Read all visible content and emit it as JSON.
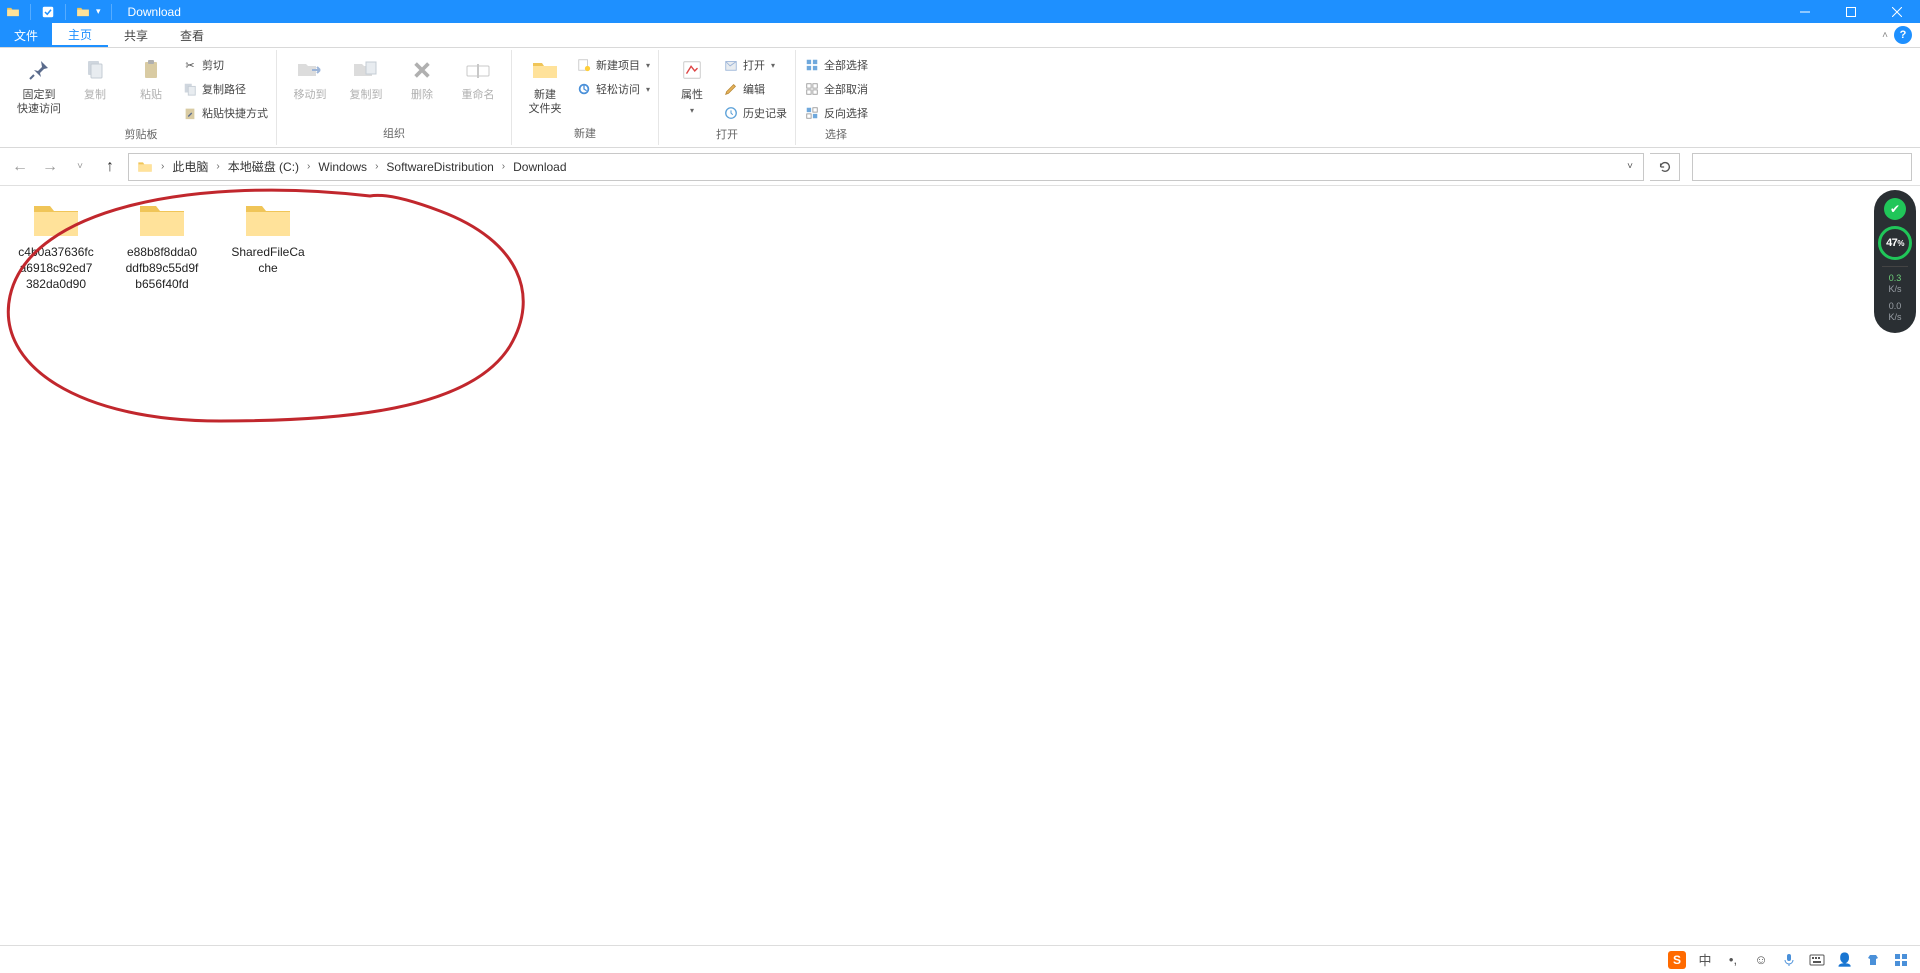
{
  "window": {
    "title": "Download"
  },
  "tabs": {
    "file": "文件",
    "items": [
      "主页",
      "共享",
      "查看"
    ],
    "active_index": 0
  },
  "ribbon": {
    "clipboard": {
      "label": "剪贴板",
      "pin": "固定到\n快速访问",
      "copy": "复制",
      "paste": "粘贴",
      "cut": "剪切",
      "copy_path": "复制路径",
      "paste_shortcut": "粘贴快捷方式"
    },
    "organize": {
      "label": "组织",
      "move_to": "移动到",
      "copy_to": "复制到",
      "delete": "删除",
      "rename": "重命名"
    },
    "new": {
      "label": "新建",
      "new_folder": "新建\n文件夹",
      "new_item": "新建项目",
      "easy_access": "轻松访问"
    },
    "open": {
      "label": "打开",
      "properties": "属性",
      "open": "打开",
      "edit": "编辑",
      "history": "历史记录"
    },
    "select": {
      "label": "选择",
      "select_all": "全部选择",
      "select_none": "全部取消",
      "invert": "反向选择"
    }
  },
  "breadcrumb": {
    "items": [
      "此电脑",
      "本地磁盘 (C:)",
      "Windows",
      "SoftwareDistribution",
      "Download"
    ]
  },
  "folders": [
    {
      "name": "c4b0a37636fca6918c92ed7382da0d90"
    },
    {
      "name": "e88b8f8dda0ddfb89c55d9fb656f40fd"
    },
    {
      "name": "SharedFileCache"
    }
  ],
  "widget": {
    "percent": "47",
    "percent_suffix": "%",
    "up": "0.3",
    "up_unit": "K/s",
    "down": "0.0",
    "down_unit": "K/s"
  },
  "ime": {
    "logo": "S",
    "lang": "中"
  }
}
